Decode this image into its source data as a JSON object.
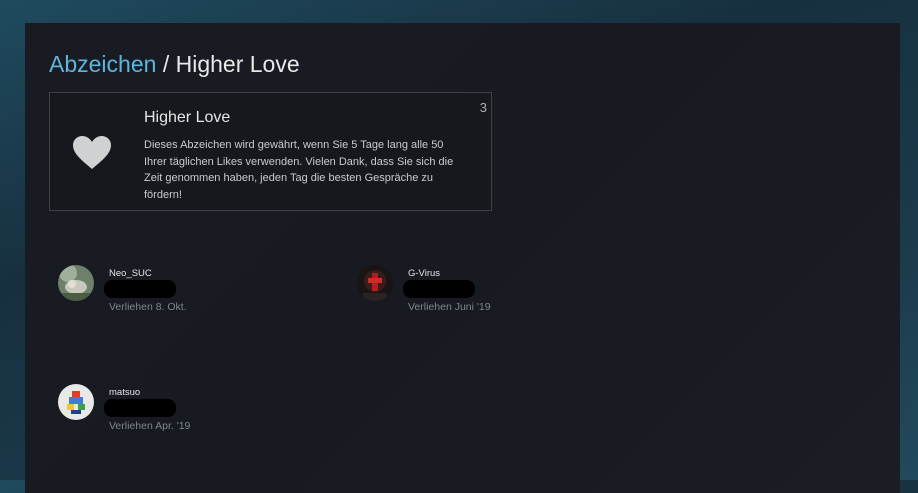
{
  "breadcrumb": {
    "link_label": "Abzeichen",
    "separator": "/",
    "current": "Higher Love"
  },
  "badge": {
    "icon": "heart-icon",
    "title": "Higher Love",
    "description": "Dieses Abzeichen wird gewährt, wenn Sie 5 Tage lang alle 50 Ihrer täglichen Likes verwenden. Vielen Dank, dass Sie sich die Zeit genommen haben, jeden Tag die besten Gespräche zu fördern!",
    "count": "3"
  },
  "users": [
    {
      "name": "Neo_SUC",
      "granted": "Verliehen 8. Okt."
    },
    {
      "name": "G-Virus",
      "granted": "Verliehen Juni '19"
    },
    {
      "name": "matsuo",
      "granted": "Verliehen Apr. '19"
    }
  ],
  "colors": {
    "link": "#5fb4de",
    "panel": "#181c22",
    "heart": "#cfd1d3"
  }
}
